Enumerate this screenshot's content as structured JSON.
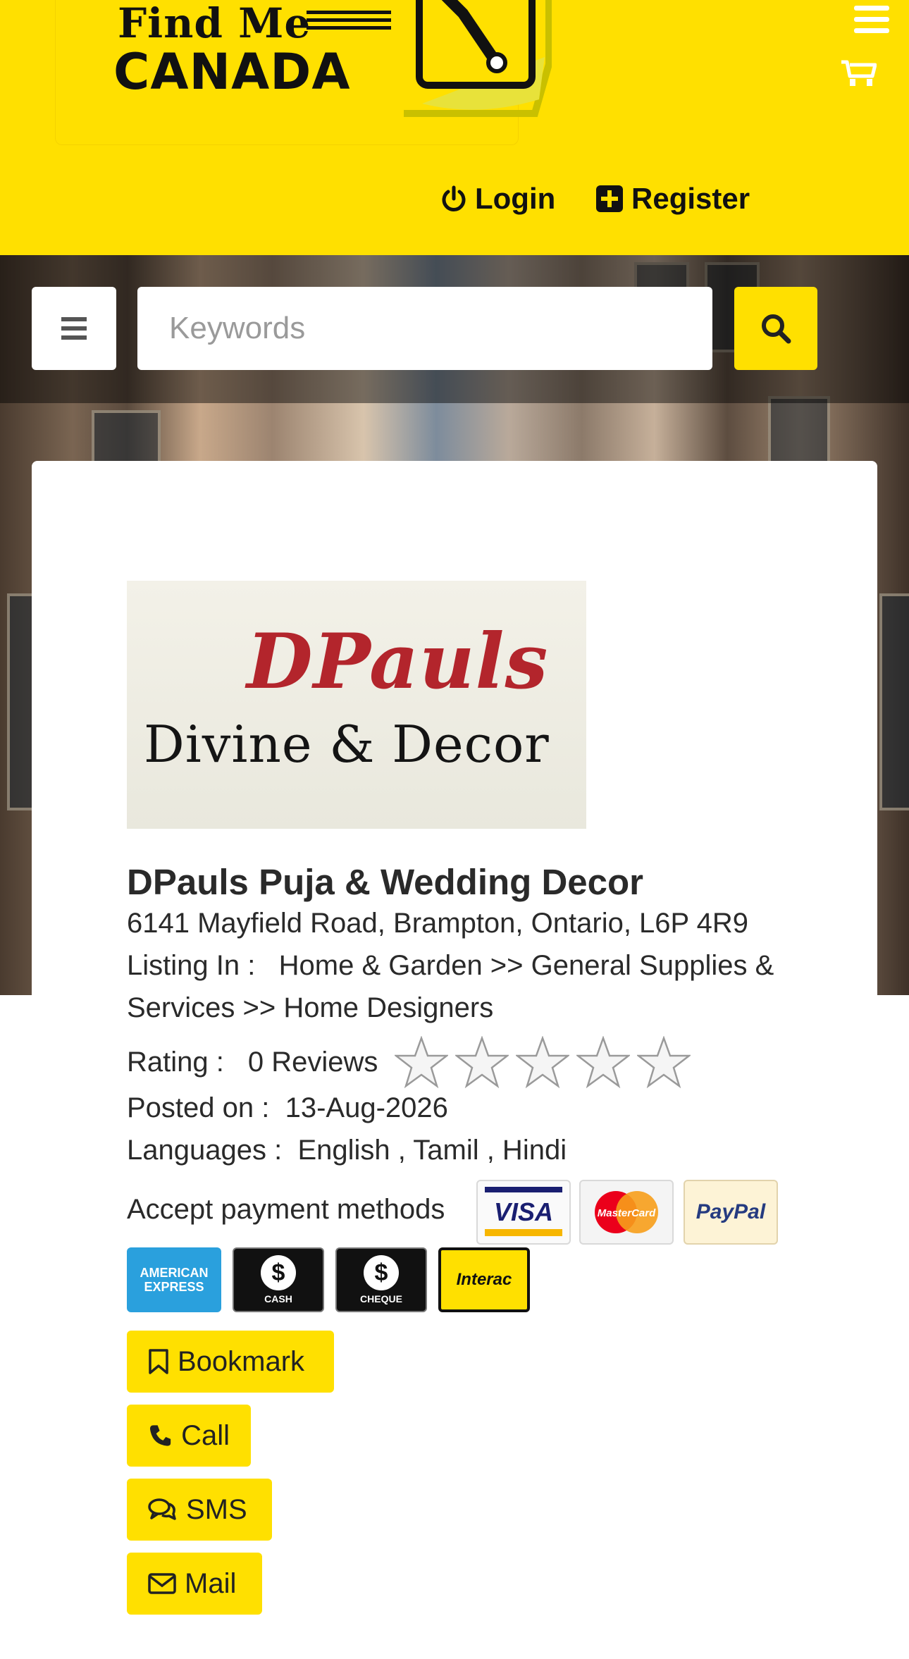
{
  "header": {
    "logo_line1": "Find Me",
    "logo_line2": "CANADA",
    "login_label": "Login",
    "register_label": "Register"
  },
  "search": {
    "placeholder": "Keywords",
    "value": ""
  },
  "listing": {
    "logo_line1": "DPauls",
    "logo_line2": "Divine & Decor",
    "name": "DPauls Puja & Wedding Decor",
    "address": "6141 Mayfield Road, Brampton, Ontario, L6P 4R9",
    "listing_in_label": "Listing In :",
    "categories": "Home & Garden >> General Supplies & Services >> Home Designers",
    "rating_label": "Rating :",
    "reviews": "0 Reviews",
    "rating_value": 0,
    "rating_max": 5,
    "posted_label": "Posted on :",
    "posted_date": "13-Aug-2026",
    "languages_label": "Languages :",
    "languages": "English , Tamil , Hindi",
    "payment_label": "Accept payment methods",
    "payment_methods": {
      "visa": "VISA",
      "mastercard": "MasterCard",
      "paypal": "PayPal",
      "amex": "AMERICAN EXPRESS",
      "cash": "CASH",
      "cheque": "CHEQUE",
      "interac": "Interac"
    }
  },
  "actions": {
    "bookmark": "Bookmark",
    "call": "Call",
    "sms": "SMS",
    "mail": "Mail"
  },
  "colors": {
    "brand_yellow": "#ffe000",
    "text_dark": "#222222"
  }
}
